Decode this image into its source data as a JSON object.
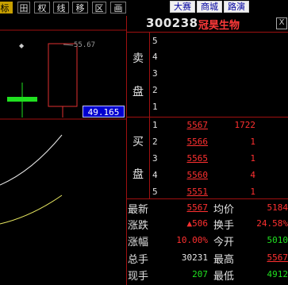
{
  "toolbar": {
    "tabs": [
      "标",
      "田",
      "权",
      "线",
      "移",
      "区",
      "画"
    ],
    "right_links": [
      "大赛",
      "商城",
      "路演"
    ]
  },
  "stock": {
    "code": "300238",
    "name": "冠昊生物"
  },
  "close_glyph": "X",
  "chart": {
    "high_label": "55.67",
    "price_tag": "49.165"
  },
  "orderbook": {
    "sell_label": [
      "卖",
      "盘"
    ],
    "buy_label": [
      "买",
      "盘"
    ],
    "sell_levels": [
      "5",
      "4",
      "3",
      "2",
      "1"
    ],
    "buy_levels": [
      {
        "level": "1",
        "price": "5567",
        "volume": "1722"
      },
      {
        "level": "2",
        "price": "5566",
        "volume": "1"
      },
      {
        "level": "3",
        "price": "5565",
        "volume": "1"
      },
      {
        "level": "4",
        "price": "5560",
        "volume": "4"
      },
      {
        "level": "5",
        "price": "5551",
        "volume": "1"
      }
    ]
  },
  "stats": {
    "latest_label": "最新",
    "latest": "5567",
    "avg_label": "均价",
    "avg": "5184",
    "change_label": "涨跌",
    "change": "▲506",
    "turnover_label": "换手",
    "turnover": "24.58%",
    "pct_label": "涨幅",
    "pct": "10.00%",
    "open_label": "今开",
    "open": "5010",
    "total_label": "总手",
    "total": "30231",
    "high_label": "最高",
    "high": "5567",
    "current_label": "现手",
    "current": "207",
    "low_label": "最低",
    "low": "4912"
  },
  "colors": {
    "up": "#ff3030",
    "down": "#20e020",
    "grid": "#a01010",
    "tag_bg": "#0000d0"
  }
}
